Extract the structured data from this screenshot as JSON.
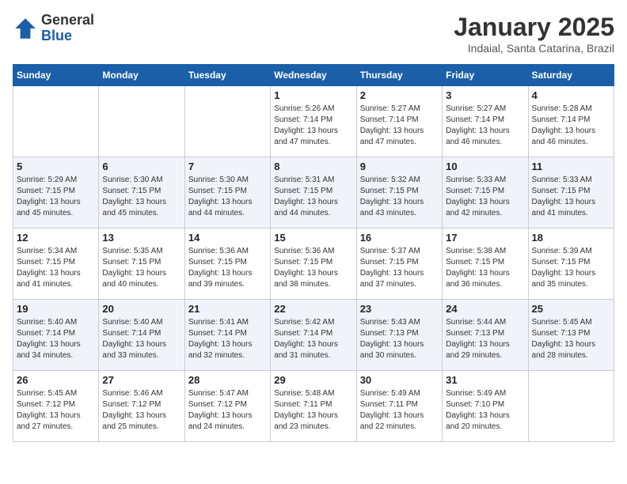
{
  "header": {
    "logo_general": "General",
    "logo_blue": "Blue",
    "month_title": "January 2025",
    "location": "Indaial, Santa Catarina, Brazil"
  },
  "days_of_week": [
    "Sunday",
    "Monday",
    "Tuesday",
    "Wednesday",
    "Thursday",
    "Friday",
    "Saturday"
  ],
  "weeks": [
    {
      "days": [
        {
          "num": "",
          "info": ""
        },
        {
          "num": "",
          "info": ""
        },
        {
          "num": "",
          "info": ""
        },
        {
          "num": "1",
          "info": "Sunrise: 5:26 AM\nSunset: 7:14 PM\nDaylight: 13 hours and 47 minutes."
        },
        {
          "num": "2",
          "info": "Sunrise: 5:27 AM\nSunset: 7:14 PM\nDaylight: 13 hours and 47 minutes."
        },
        {
          "num": "3",
          "info": "Sunrise: 5:27 AM\nSunset: 7:14 PM\nDaylight: 13 hours and 46 minutes."
        },
        {
          "num": "4",
          "info": "Sunrise: 5:28 AM\nSunset: 7:14 PM\nDaylight: 13 hours and 46 minutes."
        }
      ]
    },
    {
      "days": [
        {
          "num": "5",
          "info": "Sunrise: 5:29 AM\nSunset: 7:15 PM\nDaylight: 13 hours and 45 minutes."
        },
        {
          "num": "6",
          "info": "Sunrise: 5:30 AM\nSunset: 7:15 PM\nDaylight: 13 hours and 45 minutes."
        },
        {
          "num": "7",
          "info": "Sunrise: 5:30 AM\nSunset: 7:15 PM\nDaylight: 13 hours and 44 minutes."
        },
        {
          "num": "8",
          "info": "Sunrise: 5:31 AM\nSunset: 7:15 PM\nDaylight: 13 hours and 44 minutes."
        },
        {
          "num": "9",
          "info": "Sunrise: 5:32 AM\nSunset: 7:15 PM\nDaylight: 13 hours and 43 minutes."
        },
        {
          "num": "10",
          "info": "Sunrise: 5:33 AM\nSunset: 7:15 PM\nDaylight: 13 hours and 42 minutes."
        },
        {
          "num": "11",
          "info": "Sunrise: 5:33 AM\nSunset: 7:15 PM\nDaylight: 13 hours and 41 minutes."
        }
      ]
    },
    {
      "days": [
        {
          "num": "12",
          "info": "Sunrise: 5:34 AM\nSunset: 7:15 PM\nDaylight: 13 hours and 41 minutes."
        },
        {
          "num": "13",
          "info": "Sunrise: 5:35 AM\nSunset: 7:15 PM\nDaylight: 13 hours and 40 minutes."
        },
        {
          "num": "14",
          "info": "Sunrise: 5:36 AM\nSunset: 7:15 PM\nDaylight: 13 hours and 39 minutes."
        },
        {
          "num": "15",
          "info": "Sunrise: 5:36 AM\nSunset: 7:15 PM\nDaylight: 13 hours and 38 minutes."
        },
        {
          "num": "16",
          "info": "Sunrise: 5:37 AM\nSunset: 7:15 PM\nDaylight: 13 hours and 37 minutes."
        },
        {
          "num": "17",
          "info": "Sunrise: 5:38 AM\nSunset: 7:15 PM\nDaylight: 13 hours and 36 minutes."
        },
        {
          "num": "18",
          "info": "Sunrise: 5:39 AM\nSunset: 7:15 PM\nDaylight: 13 hours and 35 minutes."
        }
      ]
    },
    {
      "days": [
        {
          "num": "19",
          "info": "Sunrise: 5:40 AM\nSunset: 7:14 PM\nDaylight: 13 hours and 34 minutes."
        },
        {
          "num": "20",
          "info": "Sunrise: 5:40 AM\nSunset: 7:14 PM\nDaylight: 13 hours and 33 minutes."
        },
        {
          "num": "21",
          "info": "Sunrise: 5:41 AM\nSunset: 7:14 PM\nDaylight: 13 hours and 32 minutes."
        },
        {
          "num": "22",
          "info": "Sunrise: 5:42 AM\nSunset: 7:14 PM\nDaylight: 13 hours and 31 minutes."
        },
        {
          "num": "23",
          "info": "Sunrise: 5:43 AM\nSunset: 7:13 PM\nDaylight: 13 hours and 30 minutes."
        },
        {
          "num": "24",
          "info": "Sunrise: 5:44 AM\nSunset: 7:13 PM\nDaylight: 13 hours and 29 minutes."
        },
        {
          "num": "25",
          "info": "Sunrise: 5:45 AM\nSunset: 7:13 PM\nDaylight: 13 hours and 28 minutes."
        }
      ]
    },
    {
      "days": [
        {
          "num": "26",
          "info": "Sunrise: 5:45 AM\nSunset: 7:12 PM\nDaylight: 13 hours and 27 minutes."
        },
        {
          "num": "27",
          "info": "Sunrise: 5:46 AM\nSunset: 7:12 PM\nDaylight: 13 hours and 25 minutes."
        },
        {
          "num": "28",
          "info": "Sunrise: 5:47 AM\nSunset: 7:12 PM\nDaylight: 13 hours and 24 minutes."
        },
        {
          "num": "29",
          "info": "Sunrise: 5:48 AM\nSunset: 7:11 PM\nDaylight: 13 hours and 23 minutes."
        },
        {
          "num": "30",
          "info": "Sunrise: 5:49 AM\nSunset: 7:11 PM\nDaylight: 13 hours and 22 minutes."
        },
        {
          "num": "31",
          "info": "Sunrise: 5:49 AM\nSunset: 7:10 PM\nDaylight: 13 hours and 20 minutes."
        },
        {
          "num": "",
          "info": ""
        }
      ]
    }
  ]
}
